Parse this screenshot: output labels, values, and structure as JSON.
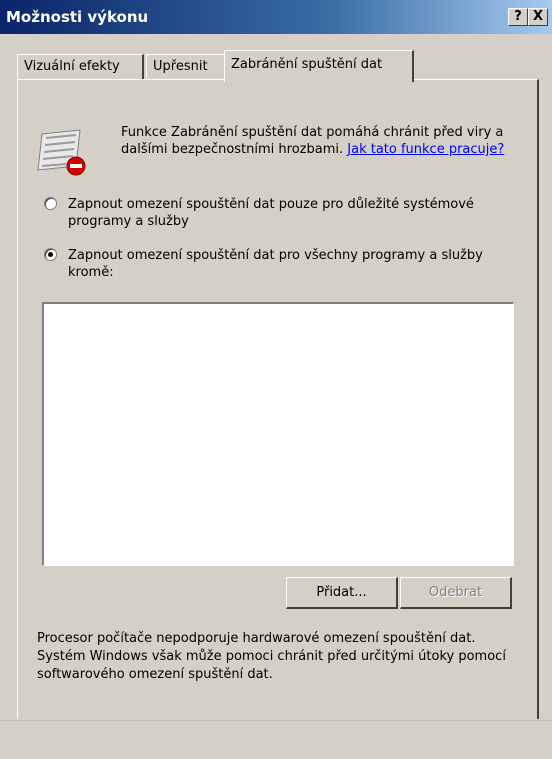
{
  "window": {
    "title": "Možnosti výkonu",
    "help_glyph": "?",
    "close_glyph": "X"
  },
  "tabs": [
    {
      "label": "Vizuální efekty",
      "active": false
    },
    {
      "label": "Upřesnit",
      "active": false
    },
    {
      "label": "Zabránění spuštění dat",
      "active": true
    }
  ],
  "description": {
    "text": "Funkce Zabránění spuštění dat pomáhá chránit před viry a dalšími bezpečnostními hrozbami.",
    "link": "Jak tato funkce pracuje?"
  },
  "options": [
    {
      "label": "Zapnout omezení spouštění dat pouze pro důležité systémové programy a služby",
      "checked": false
    },
    {
      "label": "Zapnout omezení spouštění dat pro všechny programy a služby kromě:",
      "checked": true
    }
  ],
  "exceptions_list": [],
  "buttons": {
    "add": "Přidat...",
    "remove": "Odebrat"
  },
  "footer": "Procesor počítače nepodporuje hardwarové omezení spouštění dat. Systém Windows však může pomoci chránit před určitými útoky pomocí softwarového omezení spuštění dat.",
  "colors": {
    "titlebar_start": "#0a246a",
    "face": "#d4d0c8",
    "link": "#0000ff"
  }
}
